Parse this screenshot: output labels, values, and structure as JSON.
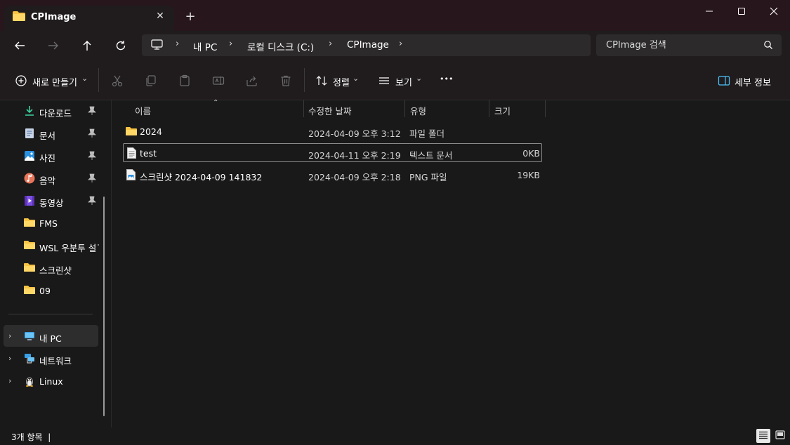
{
  "window": {
    "tab_title": "CPImage",
    "tab_close": "✕",
    "new_tab": "+"
  },
  "address": {
    "crumbs": [
      "내 PC",
      "로컬 디스크 (C:)",
      "CPImage"
    ],
    "separator": "›"
  },
  "search": {
    "placeholder": "CPImage 검색"
  },
  "toolbar": {
    "new_label": "새로 만들기",
    "sort_label": "정렬",
    "view_label": "보기",
    "more_label": "•••",
    "details_label": "세부 정보",
    "dropdown_glyph": "⌄"
  },
  "sidebar": {
    "quick_access": [
      {
        "label": "다운로드",
        "icon": "download-icon",
        "pinned": true
      },
      {
        "label": "문서",
        "icon": "document-icon",
        "pinned": true
      },
      {
        "label": "사진",
        "icon": "pictures-icon",
        "pinned": true
      },
      {
        "label": "음악",
        "icon": "music-icon",
        "pinned": true
      },
      {
        "label": "동영상",
        "icon": "video-icon",
        "pinned": true
      },
      {
        "label": "FMS",
        "icon": "folder-icon",
        "pinned": false
      },
      {
        "label": "WSL 우분투 설ᄀ",
        "icon": "folder-icon",
        "pinned": false
      },
      {
        "label": "스크린샷",
        "icon": "folder-icon",
        "pinned": false
      },
      {
        "label": "09",
        "icon": "folder-icon",
        "pinned": false
      }
    ],
    "locations": [
      {
        "label": "내 PC",
        "icon": "this-pc-icon",
        "selected": true
      },
      {
        "label": "네트워크",
        "icon": "network-icon",
        "selected": false
      },
      {
        "label": "Linux",
        "icon": "linux-icon",
        "selected": false
      }
    ],
    "expand_glyph": "›"
  },
  "file_list": {
    "columns": {
      "name": "이름",
      "modified": "수정한 날짜",
      "type": "유형",
      "size": "크기"
    },
    "sort_glyph": "⌃",
    "rows": [
      {
        "name": "2024",
        "modified": "2024-04-09 오후 3:12",
        "type": "파일 폴더",
        "size": "",
        "icon": "folder-icon"
      },
      {
        "name": "test",
        "modified": "2024-04-11 오후 2:19",
        "type": "텍스트 문서",
        "size": "0KB",
        "icon": "text-file-icon",
        "focused": true
      },
      {
        "name": "스크린샷 2024-04-09 141832",
        "modified": "2024-04-09 오후 2:18",
        "type": "PNG 파일",
        "size": "19KB",
        "icon": "png-file-icon"
      }
    ]
  },
  "status": {
    "text": "3개 항목  |"
  },
  "colors": {
    "titlebar": "#27161b",
    "background": "#191919",
    "folder": "#f6c344",
    "accent": "#4cc2ff"
  }
}
